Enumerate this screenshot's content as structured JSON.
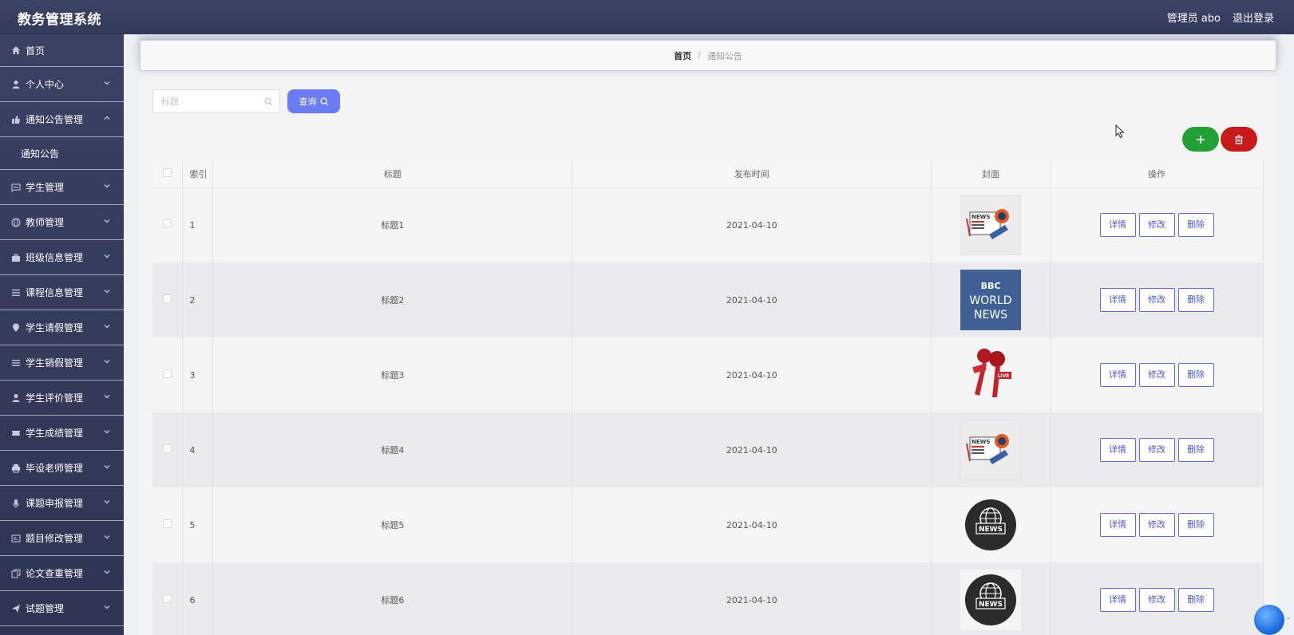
{
  "app": {
    "title": "教务管理系统",
    "user": "管理员 abo",
    "logout": "退出登录"
  },
  "sidebar": {
    "items": [
      {
        "label": "首页",
        "icon": "home-icon",
        "expandable": false
      },
      {
        "label": "个人中心",
        "icon": "user-icon",
        "expandable": true
      },
      {
        "label": "通知公告管理",
        "icon": "thumbs-icon",
        "expandable": true,
        "expanded": true,
        "children": [
          {
            "label": "通知公告"
          }
        ]
      },
      {
        "label": "学生管理",
        "icon": "message-icon",
        "expandable": true
      },
      {
        "label": "教师管理",
        "icon": "globe-icon",
        "expandable": true
      },
      {
        "label": "班级信息管理",
        "icon": "briefcase-icon",
        "expandable": true
      },
      {
        "label": "课程信息管理",
        "icon": "list-icon",
        "expandable": true
      },
      {
        "label": "学生请假管理",
        "icon": "location-icon",
        "expandable": true
      },
      {
        "label": "学生销假管理",
        "icon": "list-icon",
        "expandable": true
      },
      {
        "label": "学生评价管理",
        "icon": "user-icon",
        "expandable": true
      },
      {
        "label": "学生成绩管理",
        "icon": "ticket-icon",
        "expandable": true
      },
      {
        "label": "毕设老师管理",
        "icon": "printer-icon",
        "expandable": true
      },
      {
        "label": "课题申报管理",
        "icon": "microphone-icon",
        "expandable": true
      },
      {
        "label": "题目修改管理",
        "icon": "card-icon",
        "expandable": true
      },
      {
        "label": "论文查重管理",
        "icon": "copy-icon",
        "expandable": true
      },
      {
        "label": "试题管理",
        "icon": "send-icon",
        "expandable": true
      }
    ]
  },
  "breadcrumb": {
    "home": "首页",
    "separator": "/",
    "current": "通知公告"
  },
  "search": {
    "placeholder": "标题",
    "value": "",
    "button": "查询"
  },
  "table": {
    "headers": {
      "index": "索引",
      "title": "标题",
      "time": "发布时间",
      "cover": "封面",
      "actions": "操作"
    },
    "actions": {
      "detail": "详情",
      "edit": "修改",
      "delete": "删除"
    },
    "rows": [
      {
        "index": "1",
        "title": "标题1",
        "time": "2021-04-10",
        "cover": "news-paper"
      },
      {
        "index": "2",
        "title": "标题2",
        "time": "2021-04-10",
        "cover": "bbc-world-news"
      },
      {
        "index": "3",
        "title": "标题3",
        "time": "2021-04-10",
        "cover": "live-microphones"
      },
      {
        "index": "4",
        "title": "标题4",
        "time": "2021-04-10",
        "cover": "news-paper"
      },
      {
        "index": "5",
        "title": "标题5",
        "time": "2021-04-10",
        "cover": "news-globe"
      },
      {
        "index": "6",
        "title": "标题6",
        "time": "2021-04-10",
        "cover": "news-globe"
      }
    ]
  },
  "covers": {
    "bbc": [
      "BBC",
      "WORLD",
      "NEWS"
    ],
    "news_label": "NEWS",
    "live_label": "LIVE"
  },
  "colors": {
    "sidebar": "#3b4163",
    "topbar": "#3d4366",
    "primary": "#6b7bf2",
    "add": "#22a036",
    "delete": "#c81a1a"
  }
}
